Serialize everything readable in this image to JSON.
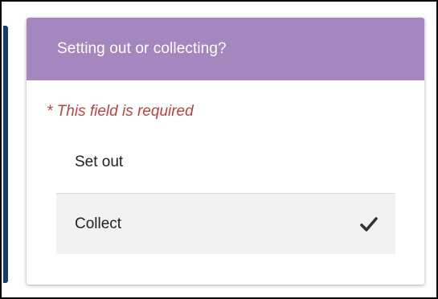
{
  "question": {
    "title": "Setting out or collecting?",
    "validation_message": "* This field is required"
  },
  "options": [
    {
      "label": "Set out",
      "selected": false
    },
    {
      "label": "Collect",
      "selected": true,
      "icon": "check-icon"
    }
  ],
  "colors": {
    "header_bg": "#a487bf",
    "header_text": "#ffffff",
    "error_text": "#b8433f",
    "selected_bg": "#f2f2f2"
  }
}
